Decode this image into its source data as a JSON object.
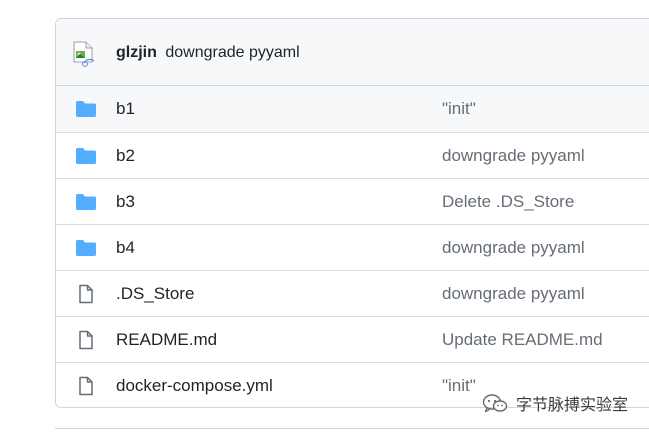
{
  "commit": {
    "author": "glzjin",
    "message": "downgrade pyyaml"
  },
  "files": [
    {
      "name": "b1",
      "type": "folder",
      "icon": "folder-icon",
      "last_commit": "\"init\""
    },
    {
      "name": "b2",
      "type": "folder",
      "icon": "folder-icon",
      "last_commit": "downgrade pyyaml"
    },
    {
      "name": "b3",
      "type": "folder",
      "icon": "folder-icon",
      "last_commit": "Delete .DS_Store"
    },
    {
      "name": "b4",
      "type": "folder",
      "icon": "folder-icon",
      "last_commit": "downgrade pyyaml"
    },
    {
      "name": ".DS_Store",
      "type": "file",
      "icon": "file-icon",
      "last_commit": "downgrade pyyaml"
    },
    {
      "name": "README.md",
      "type": "file",
      "icon": "file-icon",
      "last_commit": "Update README.md"
    },
    {
      "name": "docker-compose.yml",
      "type": "file",
      "icon": "file-icon",
      "last_commit": "\"init\""
    }
  ],
  "watermark": {
    "text": "字节脉搏实验室",
    "icon": "wechat-icon"
  },
  "colors": {
    "folder": "#54aeff",
    "file_icon": "#656d76",
    "header_bg": "#f6f8fa",
    "border": "#d0d7de"
  }
}
